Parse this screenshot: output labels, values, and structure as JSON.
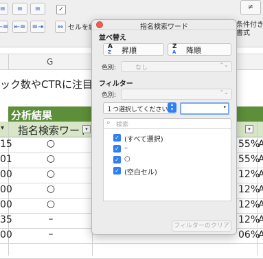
{
  "toolbar": {
    "wrap_check_mark": "✓",
    "merge_label": "セルを結合",
    "right_button_glyph": "≠",
    "right_label": "条件付き\n書式",
    "align_buttons": [
      "≡",
      "≡",
      "≡",
      "⇤≡",
      "≡⇥"
    ]
  },
  "sheet": {
    "column_letter": "G",
    "text_line": "ック数やCTRに注目して",
    "section_title": "分析結果",
    "header_label": "指名検索ワード",
    "rows": [
      {
        "num": "15",
        "mark": "○",
        "pct": "55%",
        "tail": "A"
      },
      {
        "num": "01",
        "mark": "○",
        "pct": "55%",
        "tail": "A"
      },
      {
        "num": "00",
        "mark": "○",
        "pct": "12%",
        "tail": "A"
      },
      {
        "num": "00",
        "mark": "○",
        "pct": "12%",
        "tail": "A"
      },
      {
        "num": "00",
        "mark": "○",
        "pct": "12%",
        "tail": "A"
      },
      {
        "num": "35",
        "mark": "–",
        "pct": "12%",
        "tail": "A"
      },
      {
        "num": "00",
        "mark": "–",
        "pct": "06%",
        "tail": "A"
      },
      {
        "num": "",
        "mark": "",
        "pct": "",
        "tail": ""
      }
    ]
  },
  "popover": {
    "title": "指名検索ワード",
    "sort_section": "並べ替え",
    "sort_asc_label": "昇順",
    "sort_desc_label": "降順",
    "az_top": "A",
    "az_bottom": "Z",
    "za_top": "Z",
    "za_bottom": "A",
    "color_label": "色別:",
    "color_value": "なし",
    "filter_section": "フィルター",
    "filter_color_label": "色別:",
    "condition_value": "１つ選択してください",
    "search_placeholder": "検索",
    "items": [
      {
        "label": "(すべて選択)",
        "checked": true
      },
      {
        "label": "–",
        "checked": true
      },
      {
        "label": "○",
        "checked": true
      },
      {
        "label": "(空白セル)",
        "checked": true
      }
    ],
    "clear_button": "フィルターのクリア"
  },
  "colors": {
    "section_bg": "#5d8e3a",
    "header_bg": "#d7e6c7",
    "accent_blue": "#2f7ef3",
    "close_red": "#ee5d50"
  }
}
